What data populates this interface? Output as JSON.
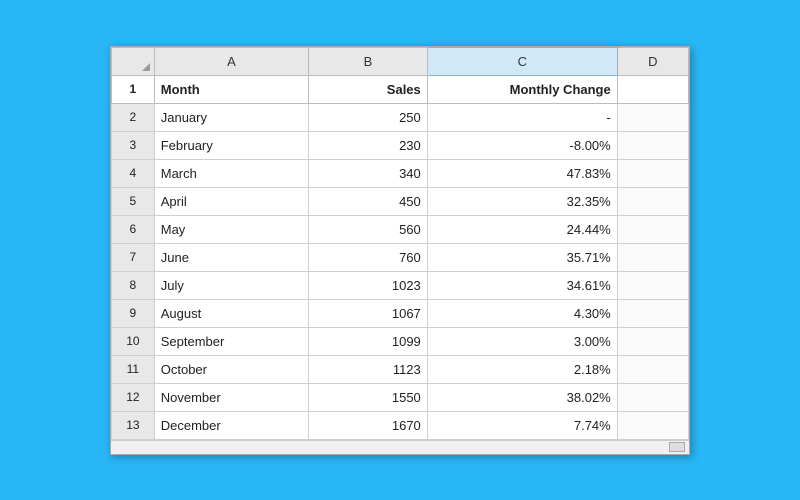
{
  "spreadsheet": {
    "columns": {
      "row_num": "",
      "a": "A",
      "b": "B",
      "c": "C",
      "d": "D"
    },
    "headers": {
      "row_num": "1",
      "a": "Month",
      "b": "Sales",
      "c": "Monthly Change",
      "d": ""
    },
    "rows": [
      {
        "row_num": "2",
        "a": "January",
        "b": "250",
        "c": "-"
      },
      {
        "row_num": "3",
        "a": "February",
        "b": "230",
        "c": "-8.00%"
      },
      {
        "row_num": "4",
        "a": "March",
        "b": "340",
        "c": "47.83%"
      },
      {
        "row_num": "5",
        "a": "April",
        "b": "450",
        "c": "32.35%"
      },
      {
        "row_num": "6",
        "a": "May",
        "b": "560",
        "c": "24.44%"
      },
      {
        "row_num": "7",
        "a": "June",
        "b": "760",
        "c": "35.71%"
      },
      {
        "row_num": "8",
        "a": "July",
        "b": "1023",
        "c": "34.61%"
      },
      {
        "row_num": "9",
        "a": "August",
        "b": "1067",
        "c": "4.30%"
      },
      {
        "row_num": "10",
        "a": "September",
        "b": "1099",
        "c": "3.00%"
      },
      {
        "row_num": "11",
        "a": "October",
        "b": "1123",
        "c": "2.18%"
      },
      {
        "row_num": "12",
        "a": "November",
        "b": "1550",
        "c": "38.02%"
      },
      {
        "row_num": "13",
        "a": "December",
        "b": "1670",
        "c": "7.74%"
      }
    ]
  }
}
